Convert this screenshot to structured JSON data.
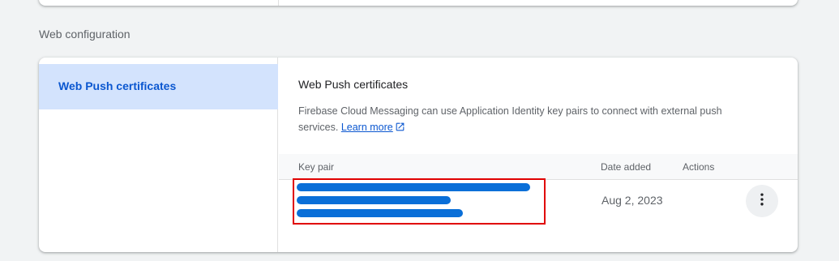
{
  "section": {
    "heading": "Web configuration"
  },
  "nav": {
    "active_item": "Web Push certificates"
  },
  "panel": {
    "title": "Web Push certificates",
    "description": "Firebase Cloud Messaging can use Application Identity key pairs to connect with external push services.",
    "learn_more": "Learn more",
    "learn_more_icon": "open-in-new-icon"
  },
  "table": {
    "columns": {
      "key_pair": "Key pair",
      "date_added": "Date added",
      "actions": "Actions"
    },
    "rows": [
      {
        "key_pair": "[redacted]",
        "date_added": "Aug 2, 2023",
        "actions_icon": "more-vert-icon"
      }
    ]
  },
  "colors": {
    "accent": "#0b57d0",
    "nav_active_bg": "#d3e3fd",
    "redaction": "#0a6fd8",
    "highlight_border": "#e00000"
  }
}
